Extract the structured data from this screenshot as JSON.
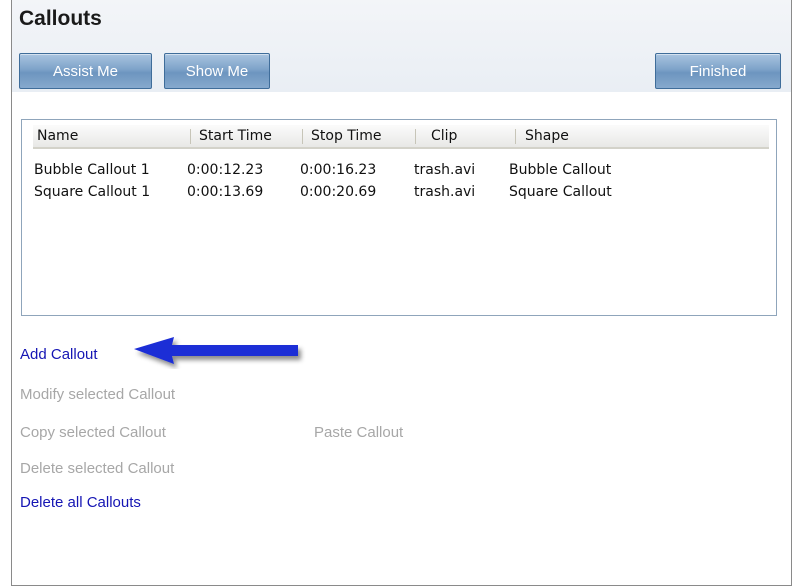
{
  "panel": {
    "title": "Callouts"
  },
  "toolbar": {
    "assist_label": "Assist Me",
    "show_label": "Show Me",
    "finished_label": "Finished"
  },
  "table": {
    "columns": [
      "Name",
      "Start Time",
      "Stop Time",
      "Clip",
      "Shape"
    ],
    "rows": [
      [
        "Bubble Callout 1",
        "0:00:12.23",
        "0:00:16.23",
        "trash.avi",
        "Bubble Callout"
      ],
      [
        "Square Callout 1",
        "0:00:13.69",
        "0:00:20.69",
        "trash.avi",
        "Square Callout"
      ]
    ]
  },
  "actions": {
    "add": "Add Callout",
    "modify": "Modify selected Callout",
    "copy": "Copy selected Callout",
    "paste": "Paste Callout",
    "delete_selected": "Delete selected Callout",
    "delete_all": "Delete all Callouts"
  },
  "colors": {
    "link": "#1515b4",
    "disabled": "#a7a7a7",
    "arrow": "#1f2fd6",
    "button": "#7ea3c9"
  }
}
